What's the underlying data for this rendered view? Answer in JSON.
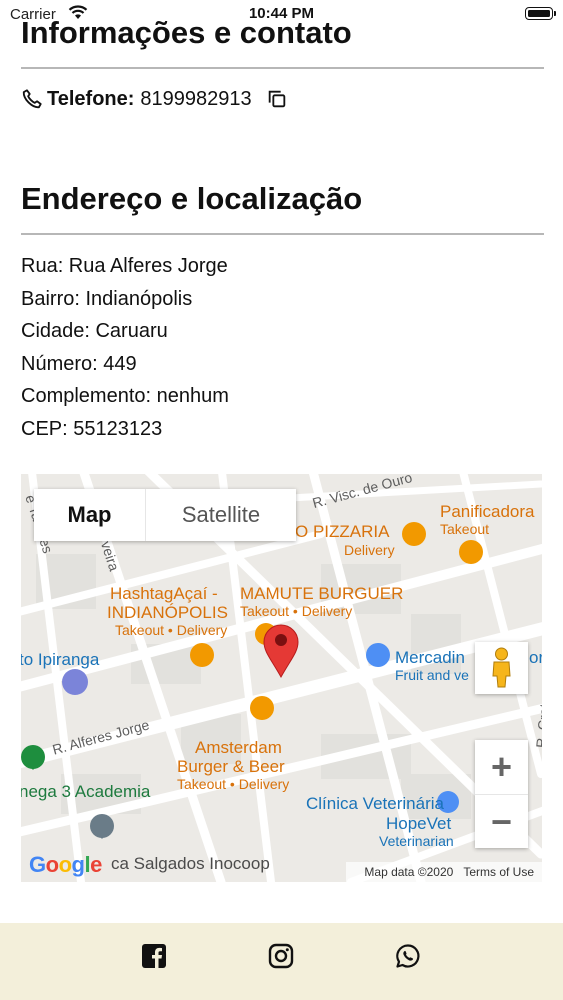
{
  "status_bar": {
    "carrier": "Carrier",
    "time": "10:44 PM"
  },
  "contact_section": {
    "title": "Informações e contato",
    "phone_label": "Telefone:",
    "phone_value": "8199982913"
  },
  "address_section": {
    "title": "Endereço e localização",
    "lines": [
      "Rua: Rua Alferes Jorge",
      "Bairro: Indianópolis",
      "Cidade: Caruaru",
      "Número: 449",
      "Complemento: nenhum",
      "CEP: 55123123"
    ]
  },
  "map": {
    "type_buttons": {
      "map": "Map",
      "satellite": "Satellite"
    },
    "zoom_in": "+",
    "zoom_out": "−",
    "attribution": {
      "data": "Map data ©2020",
      "terms": "Terms of Use"
    },
    "google": "Google",
    "streets": {
      "visc": "R. Visc. de Ouro",
      "alferes": "R. Alferes Jorge",
      "tavares": "e Tavares",
      "oliveira": "veira",
      "crato": "R. Crato"
    },
    "places": {
      "pizzaria": "O PIZZARIA",
      "pizzaria_sub": "Delivery",
      "panificadora": "Panificadora",
      "panificadora_sub": "Takeout",
      "hashtag": "HashtagAçaí -",
      "hashtag2": "INDIANÓPOLIS",
      "hashtag_sub": "Takeout • Delivery",
      "mamute": "MAMUTE BURGUER",
      "mamute_sub": "Takeout • Delivery",
      "ipiranga": "to Ipiranga",
      "mercadinho": "Mercadin",
      "mercadinho_end": "ora",
      "mercadinho_sub": "Fruit and ve",
      "amsterdam": "Amsterdam",
      "amsterdam2": "Burger & Beer",
      "amsterdam_sub": "Takeout • Delivery",
      "academia": "nega 3 Academia",
      "clinica": "Clínica Veterinária",
      "clinica2": "HopeVet",
      "clinica_sub": "Veterinarian",
      "salgados": "ca Salgados Inocoop"
    }
  },
  "colors": {
    "footer_bg": "#f3efda",
    "divider": "#b7b7b7",
    "pin": "#e53935",
    "poi_orange": "#f29900",
    "poi_blue": "#4e8ff4"
  },
  "footer": {
    "icons": [
      "facebook-icon",
      "instagram-icon",
      "whatsapp-icon"
    ]
  }
}
